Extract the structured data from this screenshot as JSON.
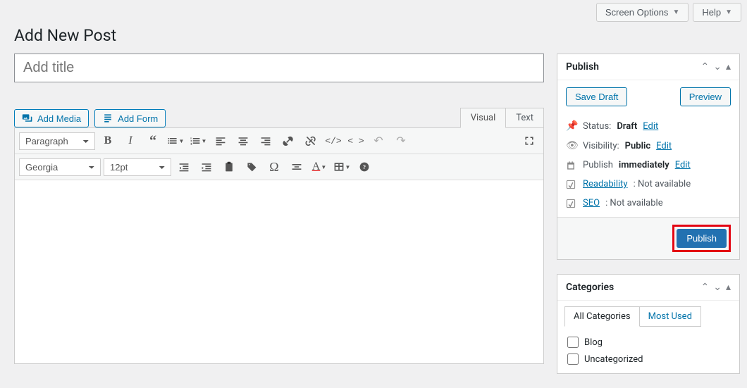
{
  "topbar": {
    "screen_options": "Screen Options",
    "help": "Help"
  },
  "page_title": "Add New Post",
  "title_placeholder": "Add title",
  "media": {
    "add_media": "Add Media",
    "add_form": "Add Form"
  },
  "editor_tabs": {
    "visual": "Visual",
    "text": "Text"
  },
  "toolbar": {
    "format": "Paragraph",
    "font": "Georgia",
    "size": "12pt"
  },
  "publish": {
    "title": "Publish",
    "save_draft": "Save Draft",
    "preview": "Preview",
    "status_label": "Status:",
    "status_value": "Draft",
    "visibility_label": "Visibility:",
    "visibility_value": "Public",
    "schedule_label": "Publish",
    "schedule_value": "immediately",
    "readability_label": "Readability",
    "readability_value": ": Not available",
    "seo_label": "SEO",
    "seo_value": ": Not available",
    "edit": "Edit",
    "publish_btn": "Publish"
  },
  "categories": {
    "title": "Categories",
    "tab_all": "All Categories",
    "tab_most": "Most Used",
    "items": [
      "Blog",
      "Uncategorized"
    ]
  }
}
